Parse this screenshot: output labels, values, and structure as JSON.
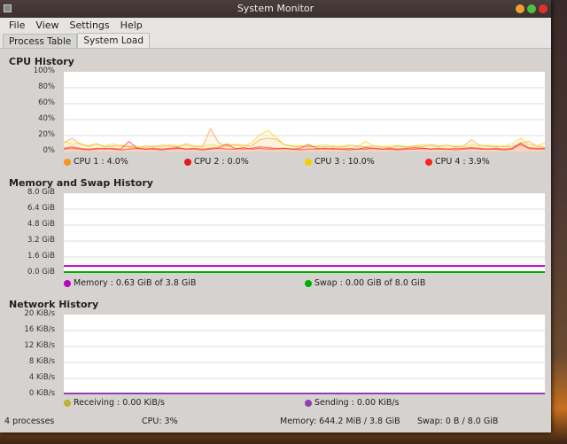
{
  "window": {
    "title": "System Monitor",
    "buttons": [
      {
        "name": "minimize",
        "color": "#f0a030"
      },
      {
        "name": "maximize",
        "color": "#50c040"
      },
      {
        "name": "close",
        "color": "#e03030"
      }
    ]
  },
  "menu": [
    "File",
    "View",
    "Settings",
    "Help"
  ],
  "tabs": [
    {
      "label": "Process Table",
      "active": false
    },
    {
      "label": "System Load",
      "active": true
    }
  ],
  "cpu": {
    "title": "CPU History",
    "yticks": [
      "100%",
      "80%",
      "60%",
      "40%",
      "20%",
      "0%"
    ],
    "chart_data": {
      "type": "line",
      "ylim": [
        0,
        100
      ],
      "grid": true,
      "series": [
        {
          "name": "CPU 1",
          "label": "CPU 1 : 4.0%",
          "color": "#f7941d",
          "values": [
            10,
            16,
            8,
            6,
            9,
            5,
            6,
            7,
            5,
            4,
            6,
            5,
            7,
            6,
            5,
            9,
            6,
            5,
            28,
            10,
            6,
            8,
            7,
            6,
            14,
            16,
            15,
            8,
            6,
            5,
            6,
            5,
            5,
            6,
            4,
            7,
            6,
            5,
            6,
            5,
            4,
            6,
            5,
            6,
            5,
            8,
            6,
            7,
            5,
            6,
            14,
            7,
            6,
            5,
            6,
            5,
            9,
            12,
            6,
            4
          ]
        },
        {
          "name": "CPU 2",
          "label": "CPU 2 : 0.0%",
          "color": "#e41a1c",
          "values": [
            2,
            3,
            2,
            1,
            2,
            3,
            2,
            1,
            2,
            3,
            2,
            2,
            1,
            2,
            3,
            2,
            2,
            1,
            2,
            3,
            2,
            2,
            4,
            2,
            3,
            2,
            2,
            3,
            2,
            1,
            2,
            2,
            3,
            2,
            2,
            1,
            2,
            2,
            3,
            2,
            2,
            1,
            2,
            2,
            3,
            2,
            2,
            2,
            1,
            2,
            3,
            2,
            2,
            2,
            1,
            2,
            8,
            3,
            2,
            2
          ]
        },
        {
          "name": "CPU 3",
          "label": "CPU 3 : 10.0%",
          "color": "#f5d000",
          "values": [
            12,
            8,
            10,
            5,
            8,
            6,
            9,
            5,
            6,
            5,
            4,
            6,
            5,
            8,
            6,
            7,
            5,
            6,
            8,
            6,
            9,
            7,
            6,
            10,
            20,
            26,
            18,
            8,
            6,
            7,
            5,
            6,
            8,
            5,
            6,
            7,
            5,
            12,
            6,
            5,
            6,
            7,
            5,
            6,
            8,
            6,
            5,
            7,
            6,
            5,
            8,
            6,
            7,
            6,
            5,
            9,
            16,
            8,
            6,
            10
          ]
        },
        {
          "name": "CPU 4",
          "label": "CPU 4 : 3.9%",
          "color": "#ff2020",
          "values": [
            3,
            5,
            3,
            2,
            3,
            2,
            3,
            2,
            12,
            3,
            2,
            3,
            2,
            3,
            4,
            2,
            3,
            2,
            3,
            4,
            8,
            3,
            2,
            3,
            5,
            4,
            3,
            3,
            2,
            3,
            8,
            3,
            2,
            3,
            2,
            3,
            2,
            4,
            3,
            2,
            3,
            2,
            3,
            4,
            3,
            2,
            3,
            2,
            3,
            3,
            4,
            3,
            2,
            3,
            2,
            3,
            10,
            4,
            3,
            3
          ]
        }
      ]
    }
  },
  "memory": {
    "title": "Memory and Swap History",
    "yticks": [
      "8.0 GiB",
      "6.4 GiB",
      "4.8 GiB",
      "3.2 GiB",
      "1.6 GiB",
      "0.0 GiB"
    ],
    "chart_data": {
      "type": "line",
      "ylim": [
        0,
        8
      ],
      "unit": "GiB",
      "grid": true,
      "series": [
        {
          "name": "Memory",
          "label": "Memory : 0.63 GiB of 3.8 GiB",
          "color": "#c000c0",
          "values": [
            0.63,
            0.63
          ]
        },
        {
          "name": "Swap",
          "label": "Swap : 0.00 GiB of 8.0 GiB",
          "color": "#00b000",
          "values": [
            0,
            0
          ]
        }
      ]
    }
  },
  "network": {
    "title": "Network History",
    "yticks": [
      "20 KiB/s",
      "16 KiB/s",
      "12 KiB/s",
      "8 KiB/s",
      "4 KiB/s",
      "0 KiB/s"
    ],
    "chart_data": {
      "type": "line",
      "ylim": [
        0,
        20
      ],
      "unit": "KiB/s",
      "grid": true,
      "series": [
        {
          "name": "Receiving",
          "label": "Receiving : 0.00 KiB/s",
          "color": "#c0b030",
          "values": [
            0,
            0
          ]
        },
        {
          "name": "Sending",
          "label": "Sending : 0.00 KiB/s",
          "color": "#9040b0",
          "values": [
            0,
            0
          ]
        }
      ]
    }
  },
  "status": {
    "processes": "4 processes",
    "cpu": "CPU: 3%",
    "memory": "Memory: 644.2 MiB / 3.8 GiB",
    "swap": "Swap: 0 B / 8.0 GiB"
  }
}
